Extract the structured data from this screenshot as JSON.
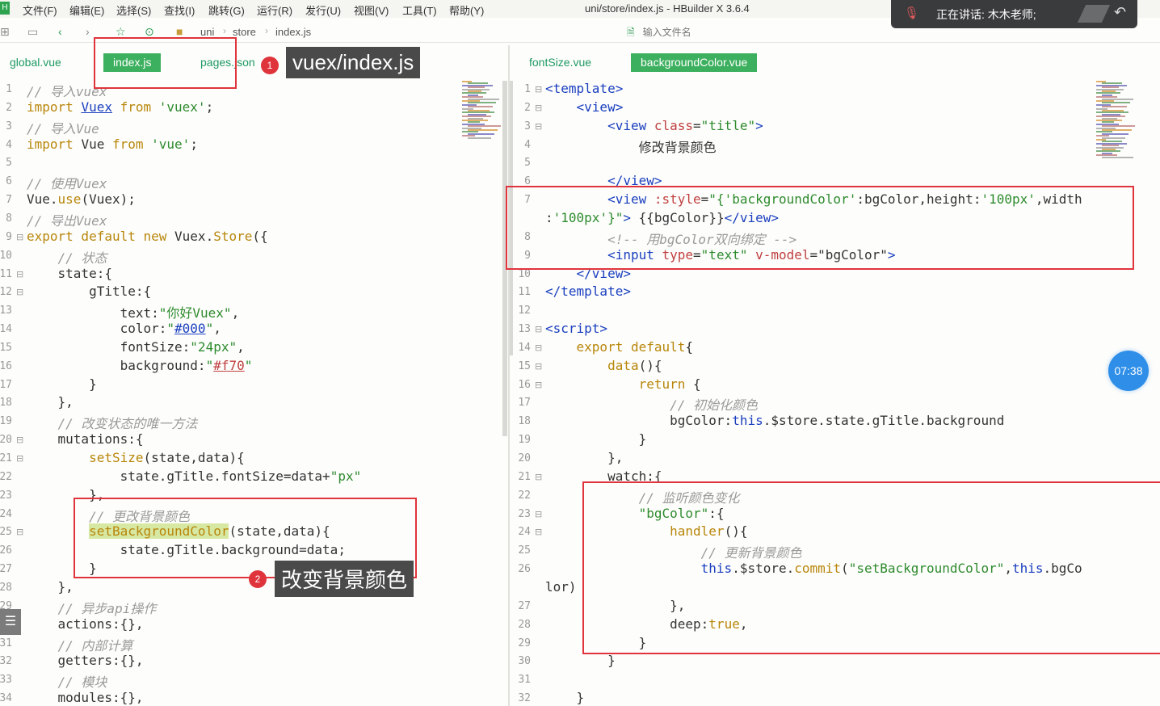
{
  "menubar": {
    "app_icon": "H",
    "items": [
      "文件(F)",
      "编辑(E)",
      "选择(S)",
      "查找(I)",
      "跳转(G)",
      "运行(R)",
      "发行(U)",
      "视图(V)",
      "工具(T)",
      "帮助(Y)"
    ],
    "window_title": "uni/store/index.js - HBuilder X 3.6.4"
  },
  "toolbar": {
    "breadcrumb": [
      "uni",
      "store",
      "index.js"
    ],
    "file_search_placeholder": "输入文件名"
  },
  "meeting": {
    "speaking_label": "正在讲话: 木木老师;"
  },
  "left_pane": {
    "tabs": [
      "global.vue",
      "index.js",
      "pages.json"
    ],
    "active_tab": 1,
    "lines": [
      {
        "n": "1",
        "f": "",
        "t": [
          [
            "// 导入vuex",
            "#9a9a9a",
            1
          ]
        ]
      },
      {
        "n": "2",
        "f": "",
        "t": [
          [
            "import ",
            "#b8860b"
          ],
          [
            "Vuex",
            "#1a3fbf",
            0,
            1
          ],
          [
            " from ",
            "#b8860b"
          ],
          [
            "'vuex'",
            "#2e8b2e"
          ],
          [
            ";",
            "#333"
          ]
        ]
      },
      {
        "n": "3",
        "f": "",
        "t": [
          [
            "// 导入Vue",
            "#9a9a9a",
            1
          ]
        ]
      },
      {
        "n": "4",
        "f": "",
        "t": [
          [
            "import ",
            "#b8860b"
          ],
          [
            "Vue",
            "#333"
          ],
          [
            " from ",
            "#b8860b"
          ],
          [
            "'vue'",
            "#2e8b2e"
          ],
          [
            ";",
            "#333"
          ]
        ]
      },
      {
        "n": "5",
        "f": "",
        "t": []
      },
      {
        "n": "6",
        "f": "",
        "t": [
          [
            "// 使用Vuex",
            "#9a9a9a",
            1
          ]
        ]
      },
      {
        "n": "7",
        "f": "",
        "t": [
          [
            "Vue.",
            "#333"
          ],
          [
            "use",
            "#b8860b"
          ],
          [
            "(Vuex);",
            "#333"
          ]
        ]
      },
      {
        "n": "8",
        "f": "",
        "t": [
          [
            "// 导出Vuex",
            "#9a9a9a",
            1
          ]
        ]
      },
      {
        "n": "9",
        "f": "⊟",
        "t": [
          [
            "export default new ",
            "#b8860b"
          ],
          [
            "Vuex.",
            "#333"
          ],
          [
            "Store",
            "#b8860b"
          ],
          [
            "({",
            "#333"
          ]
        ]
      },
      {
        "n": "10",
        "f": "",
        "t": [
          [
            "    // 状态",
            "#9a9a9a",
            1
          ]
        ]
      },
      {
        "n": "11",
        "f": "⊟",
        "t": [
          [
            "    state:{",
            "#333"
          ]
        ]
      },
      {
        "n": "12",
        "f": "⊟",
        "t": [
          [
            "        gTitle:{",
            "#333"
          ]
        ]
      },
      {
        "n": "13",
        "f": "",
        "t": [
          [
            "            text:",
            "#333"
          ],
          [
            "\"你好Vuex\"",
            "#2e8b2e"
          ],
          [
            ",",
            "#333"
          ]
        ]
      },
      {
        "n": "14",
        "f": "",
        "t": [
          [
            "            color:",
            "#333"
          ],
          [
            "\"",
            "#2e8b2e"
          ],
          [
            "#000",
            "#1a3fbf",
            0,
            1
          ],
          [
            "\"",
            "#2e8b2e"
          ],
          [
            ",",
            "#333"
          ]
        ]
      },
      {
        "n": "15",
        "f": "",
        "t": [
          [
            "            fontSize:",
            "#333"
          ],
          [
            "\"24px\"",
            "#2e8b2e"
          ],
          [
            ",",
            "#333"
          ]
        ]
      },
      {
        "n": "16",
        "f": "",
        "t": [
          [
            "            background:",
            "#333"
          ],
          [
            "\"",
            "#2e8b2e"
          ],
          [
            "#f70",
            "#c04040",
            0,
            1
          ],
          [
            "\"",
            "#2e8b2e"
          ]
        ]
      },
      {
        "n": "17",
        "f": "",
        "t": [
          [
            "        }",
            "#333"
          ]
        ]
      },
      {
        "n": "18",
        "f": "",
        "t": [
          [
            "    },",
            "#333"
          ]
        ]
      },
      {
        "n": "19",
        "f": "",
        "t": [
          [
            "    // 改变状态的唯一方法",
            "#9a9a9a",
            1
          ]
        ]
      },
      {
        "n": "20",
        "f": "⊟",
        "t": [
          [
            "    mutations:{",
            "#333"
          ]
        ]
      },
      {
        "n": "21",
        "f": "⊟",
        "t": [
          [
            "        ",
            "#333"
          ],
          [
            "setSize",
            "#b8860b"
          ],
          [
            "(state,data){",
            "#333"
          ]
        ]
      },
      {
        "n": "22",
        "f": "",
        "t": [
          [
            "            state.gTitle.fontSize=data+",
            "#333"
          ],
          [
            "\"px\"",
            "#2e8b2e"
          ]
        ]
      },
      {
        "n": "23",
        "f": "",
        "t": [
          [
            "        },",
            "#333"
          ]
        ]
      },
      {
        "n": "24",
        "f": "",
        "t": [
          [
            "        // 更改背景颜色",
            "#9a9a9a",
            1
          ]
        ]
      },
      {
        "n": "25",
        "f": "⊟",
        "t": [
          [
            "        ",
            "#333"
          ],
          [
            "setBackgroundColor",
            "#b8860b",
            0,
            0,
            1
          ],
          [
            "(state,data){",
            "#333"
          ]
        ]
      },
      {
        "n": "26",
        "f": "",
        "t": [
          [
            "            state.gTitle.background=data;",
            "#333"
          ]
        ]
      },
      {
        "n": "27",
        "f": "",
        "t": [
          [
            "        }",
            "#333"
          ]
        ]
      },
      {
        "n": "28",
        "f": "",
        "t": [
          [
            "    },",
            "#333"
          ]
        ]
      },
      {
        "n": "29",
        "f": "",
        "t": [
          [
            "    // 异步api操作",
            "#9a9a9a",
            1
          ]
        ]
      },
      {
        "n": "30",
        "f": "",
        "t": [
          [
            "    actions:{},",
            "#333"
          ]
        ]
      },
      {
        "n": "31",
        "f": "",
        "t": [
          [
            "    // 内部计算",
            "#9a9a9a",
            1
          ]
        ]
      },
      {
        "n": "32",
        "f": "",
        "t": [
          [
            "    getters:{},",
            "#333"
          ]
        ]
      },
      {
        "n": "33",
        "f": "",
        "t": [
          [
            "    // 模块",
            "#9a9a9a",
            1
          ]
        ]
      },
      {
        "n": "34",
        "f": "",
        "t": [
          [
            "    modules:{},",
            "#333"
          ]
        ]
      }
    ]
  },
  "right_pane": {
    "tabs": [
      "fontSize.vue",
      "backgroundColor.vue"
    ],
    "active_tab": 1,
    "lines": [
      {
        "n": "1",
        "f": "⊟",
        "t": [
          [
            "<template>",
            "#1a3fbf"
          ]
        ]
      },
      {
        "n": "2",
        "f": "⊟",
        "t": [
          [
            "    <view>",
            "#1a3fbf"
          ]
        ]
      },
      {
        "n": "3",
        "f": "⊟",
        "t": [
          [
            "        <view ",
            "#1a3fbf"
          ],
          [
            "class",
            "#c04040"
          ],
          [
            "=",
            "#333"
          ],
          [
            "\"title\"",
            "#2e8b2e"
          ],
          [
            ">",
            "#1a3fbf"
          ]
        ]
      },
      {
        "n": "4",
        "f": "",
        "t": [
          [
            "            修改背景颜色",
            "#333"
          ]
        ]
      },
      {
        "n": "5",
        "f": "",
        "t": []
      },
      {
        "n": "6",
        "f": "",
        "t": [
          [
            "        </view>",
            "#1a3fbf"
          ]
        ]
      },
      {
        "n": "7",
        "f": "",
        "t": [
          [
            "        <view ",
            "#1a3fbf"
          ],
          [
            ":style",
            "#c04040"
          ],
          [
            "=",
            "#333"
          ],
          [
            "\"{",
            "#2e8b2e"
          ],
          [
            "'backgroundColor'",
            "#2e8b2e"
          ],
          [
            ":bgColor,height:",
            "#333"
          ],
          [
            "'100px'",
            "#2e8b2e"
          ],
          [
            ",width",
            "#333"
          ]
        ]
      },
      {
        "n": "",
        "f": "",
        "t": [
          [
            ":",
            "#333"
          ],
          [
            "'100px'",
            "#2e8b2e"
          ],
          [
            "}\"",
            "#2e8b2e"
          ],
          [
            ">",
            "#1a3fbf"
          ],
          [
            " {{bgColor}}",
            "#333"
          ],
          [
            "</view>",
            "#1a3fbf"
          ]
        ]
      },
      {
        "n": "8",
        "f": "",
        "t": [
          [
            "        <!-- 用bgColor双向绑定 -->",
            "#9a9a9a",
            1
          ]
        ]
      },
      {
        "n": "9",
        "f": "",
        "t": [
          [
            "        <input ",
            "#1a3fbf"
          ],
          [
            "type",
            "#c04040"
          ],
          [
            "=",
            "#333"
          ],
          [
            "\"text\"",
            "#2e8b2e"
          ],
          [
            " v-model",
            "#c04040"
          ],
          [
            "=",
            "#333"
          ],
          [
            "\"bgColor\"",
            "#333"
          ],
          [
            ">",
            "#1a3fbf"
          ]
        ]
      },
      {
        "n": "10",
        "f": "",
        "t": [
          [
            "    </view>",
            "#1a3fbf"
          ]
        ]
      },
      {
        "n": "11",
        "f": "",
        "t": [
          [
            "</template>",
            "#1a3fbf"
          ]
        ]
      },
      {
        "n": "12",
        "f": "",
        "t": []
      },
      {
        "n": "13",
        "f": "⊟",
        "t": [
          [
            "<script>",
            "#1a3fbf"
          ]
        ]
      },
      {
        "n": "14",
        "f": "⊟",
        "t": [
          [
            "    export default",
            "#b8860b"
          ],
          [
            "{",
            "#333"
          ]
        ]
      },
      {
        "n": "15",
        "f": "⊟",
        "t": [
          [
            "        data",
            "#b8860b"
          ],
          [
            "(){",
            "#333"
          ]
        ]
      },
      {
        "n": "16",
        "f": "⊟",
        "t": [
          [
            "            return ",
            "#b8860b"
          ],
          [
            "{",
            "#333"
          ]
        ]
      },
      {
        "n": "17",
        "f": "",
        "t": [
          [
            "                // 初始化颜色",
            "#9a9a9a",
            1
          ]
        ]
      },
      {
        "n": "18",
        "f": "",
        "t": [
          [
            "                bgColor:",
            "#333"
          ],
          [
            "this",
            "#1a3fbf"
          ],
          [
            ".$store.state.gTitle.background",
            "#333"
          ]
        ]
      },
      {
        "n": "19",
        "f": "",
        "t": [
          [
            "            }",
            "#333"
          ]
        ]
      },
      {
        "n": "20",
        "f": "",
        "t": [
          [
            "        },",
            "#333"
          ]
        ]
      },
      {
        "n": "21",
        "f": "⊟",
        "t": [
          [
            "        watch:{",
            "#333"
          ]
        ]
      },
      {
        "n": "22",
        "f": "",
        "t": [
          [
            "            // 监听颜色变化",
            "#9a9a9a",
            1
          ]
        ]
      },
      {
        "n": "23",
        "f": "⊟",
        "t": [
          [
            "            ",
            "#333"
          ],
          [
            "\"bgColor\"",
            "#2e8b2e"
          ],
          [
            ":{",
            "#333"
          ]
        ]
      },
      {
        "n": "24",
        "f": "⊟",
        "t": [
          [
            "                handler",
            "#b8860b"
          ],
          [
            "(){",
            "#333"
          ]
        ]
      },
      {
        "n": "25",
        "f": "",
        "t": [
          [
            "                    // 更新背景颜色",
            "#9a9a9a",
            1
          ]
        ]
      },
      {
        "n": "26",
        "f": "",
        "t": [
          [
            "                    ",
            "#333"
          ],
          [
            "this",
            "#1a3fbf"
          ],
          [
            ".$store.",
            "#333"
          ],
          [
            "commit",
            "#b8860b"
          ],
          [
            "(",
            "#333"
          ],
          [
            "\"setBackgroundColor\"",
            "#2e8b2e"
          ],
          [
            ",",
            "#333"
          ],
          [
            "this",
            "#1a3fbf"
          ],
          [
            ".bgCo",
            "#333"
          ]
        ]
      },
      {
        "n": "",
        "f": "",
        "t": [
          [
            "lor)",
            "#333"
          ]
        ]
      },
      {
        "n": "27",
        "f": "",
        "t": [
          [
            "                },",
            "#333"
          ]
        ]
      },
      {
        "n": "28",
        "f": "",
        "t": [
          [
            "                deep:",
            "#333"
          ],
          [
            "true",
            "#b8860b"
          ],
          [
            ",",
            "#333"
          ]
        ]
      },
      {
        "n": "29",
        "f": "",
        "t": [
          [
            "            }",
            "#333"
          ]
        ]
      },
      {
        "n": "30",
        "f": "",
        "t": [
          [
            "        }",
            "#333"
          ]
        ]
      },
      {
        "n": "31",
        "f": "",
        "t": []
      },
      {
        "n": "32",
        "f": "",
        "t": [
          [
            "    }",
            "#333"
          ]
        ]
      }
    ]
  },
  "annotations": {
    "callout_1": {
      "number": "1",
      "label": "vuex/index.js"
    },
    "callout_2": {
      "number": "2",
      "label": "改变背景颜色"
    }
  },
  "recording_timer": "07:38",
  "colors": {
    "accent_green": "#3db05f",
    "tab_text": "#1e9a63",
    "annotation_red": "#e0343c",
    "timer_blue": "#2f8fe8"
  }
}
